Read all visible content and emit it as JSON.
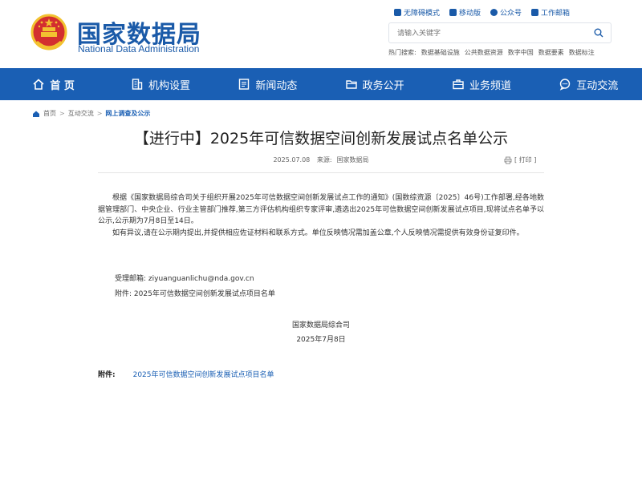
{
  "header": {
    "title_cn": "国家数据局",
    "title_en": "National Data Administration",
    "quick_links": [
      {
        "label": "无障碍模式",
        "icon": "accessibility-icon"
      },
      {
        "label": "移动版",
        "icon": "mobile-icon"
      },
      {
        "label": "公众号",
        "icon": "wechat-icon"
      },
      {
        "label": "工作邮箱",
        "icon": "mail-icon"
      }
    ],
    "search": {
      "placeholder": "请输入关键字"
    },
    "hot_search": {
      "label": "热门搜索:",
      "items": [
        "数据基础设施",
        "公共数据资源",
        "数字中国",
        "数据要素",
        "数据标注"
      ]
    }
  },
  "nav": {
    "items": [
      {
        "label": "首 页",
        "icon": "home-icon"
      },
      {
        "label": "机构设置",
        "icon": "building-icon"
      },
      {
        "label": "新闻动态",
        "icon": "news-icon"
      },
      {
        "label": "政务公开",
        "icon": "folder-icon"
      },
      {
        "label": "业务频道",
        "icon": "briefcase-icon"
      },
      {
        "label": "互动交流",
        "icon": "chat-icon"
      }
    ]
  },
  "breadcrumb": {
    "items": [
      "首页",
      "互动交流",
      "网上调查及公示"
    ]
  },
  "article": {
    "title": "【进行中】2025年可信数据空间创新发展试点名单公示",
    "date": "2025.07.08",
    "source_label": "来源:",
    "source": "国家数据局",
    "print_label": "[ 打印 ]",
    "paragraphs": [
      "根据《国家数据局综合司关于组织开展2025年可信数据空间创新发展试点工作的通知》(国数综资源〔2025〕46号)工作部署,经各地数据管理部门、中央企业、行业主管部门推荐,第三方评估机构组织专家评审,遴选出2025年可信数据空间创新发展试点项目,现将试点名单予以公示,公示期为7月8日至14日。",
      "如有异议,请在公示期内提出,并提供相应佐证材料和联系方式。单位反映情况需加盖公章,个人反映情况需提供有效身份证复印件。"
    ],
    "email_label": "受理邮箱:",
    "email": "ziyuanguanlichu@nda.gov.cn",
    "attachment_label": "附件:",
    "attachment_name": "2025年可信数据空间创新发展试点项目名单",
    "signature": "国家数据局综合司",
    "sign_date": "2025年7月8日",
    "bottom_attachment_label": "附件:",
    "bottom_attachment_link": "2025年可信数据空间创新发展试点项目名单"
  },
  "colors": {
    "brand": "#1a5aa8",
    "nav_bg": "#1a5fb4",
    "emblem_red": "#d32f2f",
    "emblem_gold": "#f2c230"
  }
}
